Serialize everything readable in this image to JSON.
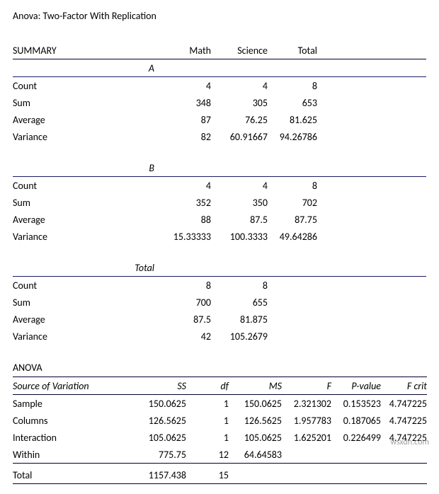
{
  "title": "Anova: Two-Factor With Replication",
  "summary_heading": "SUMMARY",
  "summary_cols": {
    "c2": "Math",
    "c3": "Science",
    "c4": "Total"
  },
  "row_labels": {
    "count": "Count",
    "sum": "Sum",
    "average": "Average",
    "variance": "Variance"
  },
  "groups": [
    {
      "name": "A",
      "count": {
        "c2": "4",
        "c3": "4",
        "c4": "8"
      },
      "sum": {
        "c2": "348",
        "c3": "305",
        "c4": "653"
      },
      "average": {
        "c2": "87",
        "c3": "76.25",
        "c4": "81.625"
      },
      "variance": {
        "c2": "82",
        "c3": "60.91667",
        "c4": "94.26786"
      }
    },
    {
      "name": "B",
      "count": {
        "c2": "4",
        "c3": "4",
        "c4": "8"
      },
      "sum": {
        "c2": "352",
        "c3": "350",
        "c4": "702"
      },
      "average": {
        "c2": "88",
        "c3": "87.5",
        "c4": "87.75"
      },
      "variance": {
        "c2": "15.33333",
        "c3": "100.3333",
        "c4": "49.64286"
      }
    },
    {
      "name": "Total",
      "count": {
        "c2": "8",
        "c3": "8",
        "c4": ""
      },
      "sum": {
        "c2": "700",
        "c3": "655",
        "c4": ""
      },
      "average": {
        "c2": "87.5",
        "c3": "81.875",
        "c4": ""
      },
      "variance": {
        "c2": "42",
        "c3": "105.2679",
        "c4": ""
      }
    }
  ],
  "anova_heading": "ANOVA",
  "anova_cols": {
    "src": "Source of Variation",
    "ss": "SS",
    "df": "df",
    "ms": "MS",
    "f": "F",
    "p": "P-value",
    "fcrit": "F crit"
  },
  "anova_rows": [
    {
      "src": "Sample",
      "ss": "150.0625",
      "df": "1",
      "ms": "150.0625",
      "f": "2.321302",
      "p": "0.153523",
      "fcrit": "4.747225"
    },
    {
      "src": "Columns",
      "ss": "126.5625",
      "df": "1",
      "ms": "126.5625",
      "f": "1.957783",
      "p": "0.187065",
      "fcrit": "4.747225"
    },
    {
      "src": "Interaction",
      "ss": "105.0625",
      "df": "1",
      "ms": "105.0625",
      "f": "1.625201",
      "p": "0.226499",
      "fcrit": "4.747225"
    },
    {
      "src": "Within",
      "ss": "775.75",
      "df": "12",
      "ms": "64.64583",
      "f": "",
      "p": "",
      "fcrit": ""
    }
  ],
  "anova_total": {
    "src": "Total",
    "ss": "1157.438",
    "df": "15"
  },
  "watermark": "wsxdn.com"
}
